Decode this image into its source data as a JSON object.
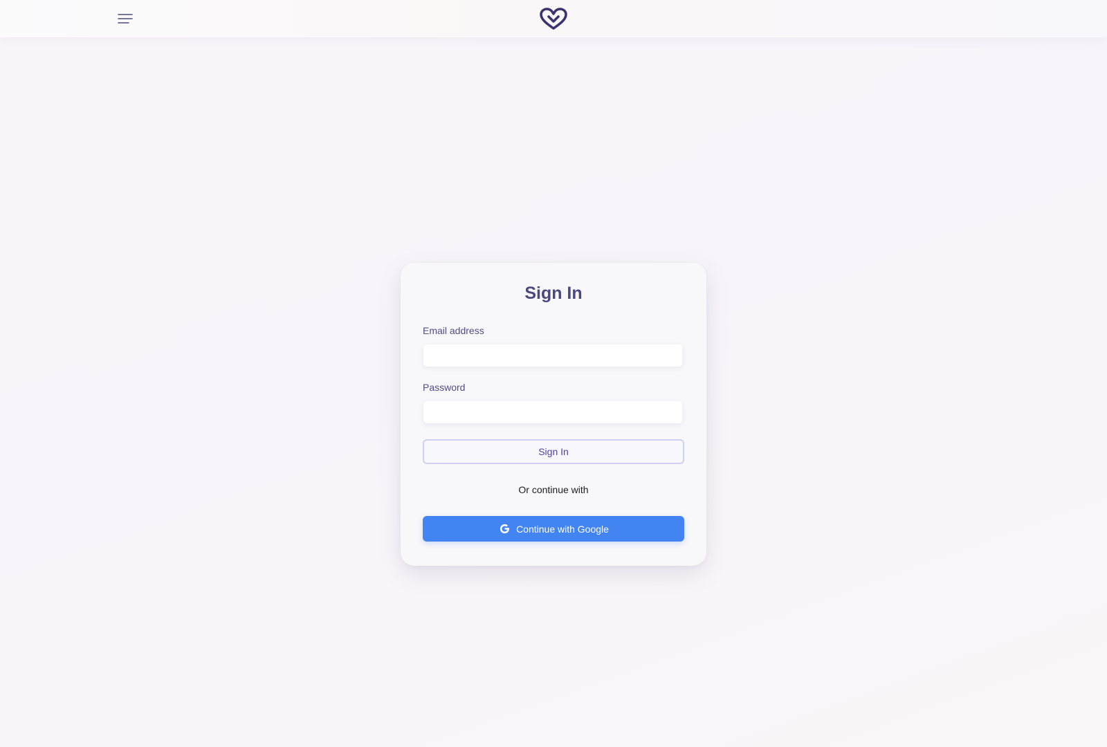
{
  "header": {
    "menu_icon": "hamburger-menu-icon",
    "logo_icon": "heart-logo-icon"
  },
  "signin_card": {
    "title": "Sign In",
    "email": {
      "label": "Email address",
      "value": "",
      "placeholder": ""
    },
    "password": {
      "label": "Password",
      "value": "",
      "placeholder": ""
    },
    "submit_label": "Sign In",
    "divider_text": "Or continue with",
    "google": {
      "label": "Continue with Google",
      "icon": "google-g-icon"
    }
  },
  "colors": {
    "brand_purple": "#4a4a7e",
    "google_blue": "#4184f2",
    "signin_border": "#cfd0f4"
  }
}
